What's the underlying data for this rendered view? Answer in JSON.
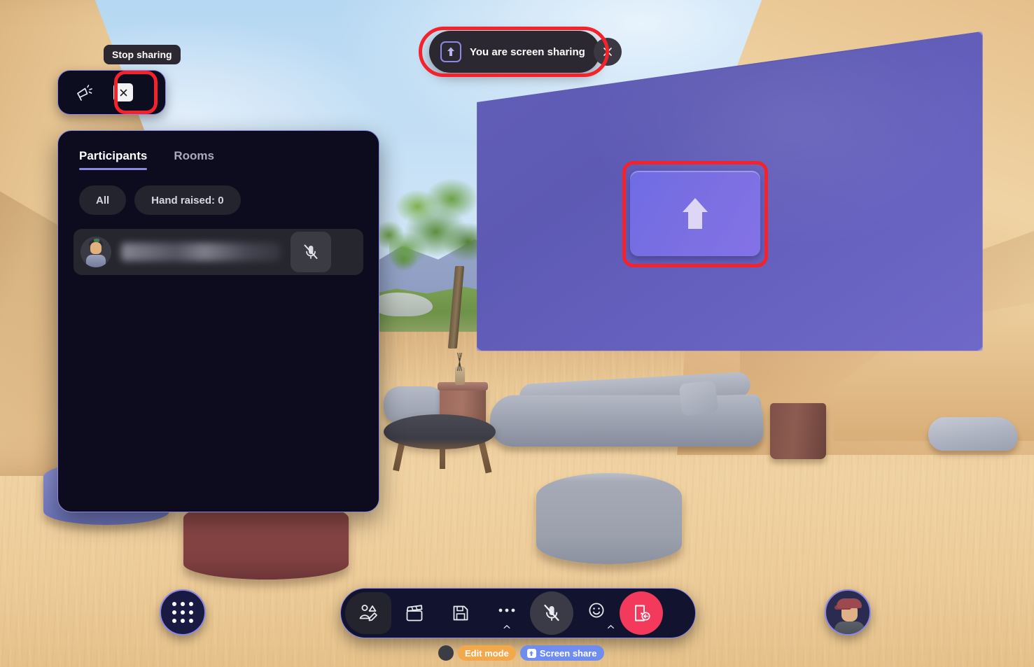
{
  "app": {
    "environment_name": "virtual-3d-meeting-room"
  },
  "toast": {
    "icon": "screen-share-upload-icon",
    "label": "You are screen sharing",
    "close_icon": "close-icon"
  },
  "mini_toolbar": {
    "tooltip": "Stop sharing",
    "announce_icon": "megaphone-icon",
    "stop_share_icon": "close-icon"
  },
  "panel": {
    "tabs": [
      {
        "label": "Participants",
        "active": true
      },
      {
        "label": "Rooms",
        "active": false
      }
    ],
    "filters": [
      {
        "label": "All"
      },
      {
        "label": "Hand raised: 0"
      }
    ],
    "participants": [
      {
        "name": "",
        "name_redacted": true,
        "avatar": "participant-avatar",
        "mic_icon": "microphone-muted-icon",
        "muted": true
      }
    ]
  },
  "big_screen": {
    "share_tile_icon": "screen-share-upload-arrow-icon"
  },
  "bottom_toolbar": {
    "apps_button_icon": "app-grid-icon",
    "buttons": [
      {
        "name": "avatar-editor",
        "icon": "avatar-edit-icon",
        "has_chevron": false
      },
      {
        "name": "media-clip",
        "icon": "clapperboard-icon",
        "has_chevron": false
      },
      {
        "name": "save",
        "icon": "floppy-save-icon",
        "has_chevron": false
      },
      {
        "name": "more-options",
        "icon": "ellipsis-icon",
        "has_chevron": true
      },
      {
        "name": "microphone",
        "icon": "microphone-muted-icon",
        "has_chevron": false
      },
      {
        "name": "reactions",
        "icon": "smiley-icon",
        "has_chevron": true
      },
      {
        "name": "leave-meeting",
        "icon": "leave-door-icon",
        "has_chevron": false
      }
    ],
    "self_avatar": "self-avatar"
  },
  "status_bar": {
    "dot": "status-indicator",
    "pills": [
      {
        "label": "Edit mode",
        "color": "#f3a84c",
        "icon": null
      },
      {
        "label": "Screen share",
        "color": "#6f8df0",
        "icon": "share-upload-icon"
      }
    ]
  },
  "highlights": [
    {
      "name": "screen-share-tile-highlight",
      "color": "#f4232b"
    },
    {
      "name": "screen-sharing-toast-highlight",
      "color": "#f4232b"
    },
    {
      "name": "stop-sharing-button-highlight",
      "color": "#f4232b"
    }
  ],
  "colors": {
    "accent_purple": "#8d88e6",
    "panel_bg": "#0c0c1e",
    "highlight_red": "#f4232b",
    "leave_red": "#f43a5c",
    "edit_mode_orange": "#f3a84c",
    "screen_share_blue": "#6f8df0"
  }
}
